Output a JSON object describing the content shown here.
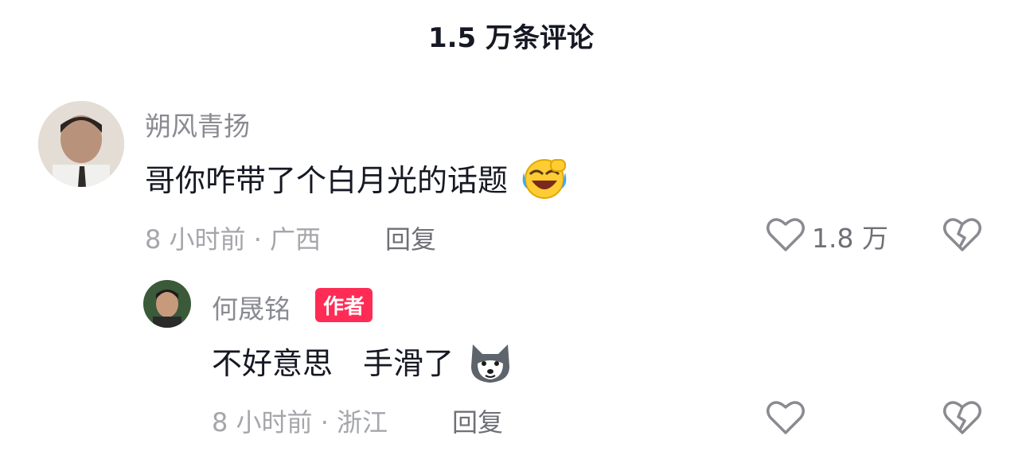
{
  "header": {
    "title": "1.5 万条评论"
  },
  "comments": [
    {
      "username": "朔风青扬",
      "content": "哥你咋带了个白月光的话题",
      "emoji": "face-with-tears-of-joy",
      "meta": "8 小时前 · 广西",
      "reply_label": "回复",
      "like_count": "1.8 万"
    },
    {
      "username": "何晟铭",
      "badge": "作者",
      "content": "不好意思　手滑了",
      "emoji": "wolf-face",
      "meta": "8 小时前 · 浙江",
      "reply_label": "回复"
    }
  ],
  "icons": {
    "like": "heart-outline-icon",
    "dislike": "broken-heart-outline-icon"
  },
  "colors": {
    "author_badge": "#fe2c55",
    "meta_text": "#a5a6ab",
    "username": "#8a8b91",
    "main_text": "#161823"
  }
}
